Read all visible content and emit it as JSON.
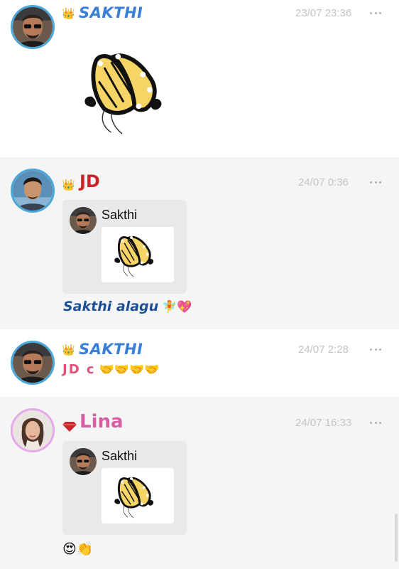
{
  "colors": {
    "post_bg_alt": "#f5f5f5",
    "timestamp": "#c4c4c4",
    "ring_blue": "#4aa7d9",
    "ring_pink": "#e4a8e8",
    "sakthi_blue": "#3a7fd6",
    "jd_red": "#c8252b",
    "lina_pink": "#d75ea3",
    "msg_blue": "#1d4f97",
    "msg_pink": "#e0527a"
  },
  "posts": [
    {
      "username": "SAKTHI",
      "badge_icon": "crown-icon",
      "timestamp": "23/07 23:36",
      "sticker": "butterfly-sticker"
    },
    {
      "username": "JD",
      "badge_icon": "crown-icon",
      "timestamp": "24/07 0:36",
      "quote": {
        "author": "Sakthi",
        "sticker": "butterfly-sticker"
      },
      "message": "Sakthi alagu",
      "emoji": "🧚💖"
    },
    {
      "username": "SAKTHI",
      "badge_icon": "crown-icon",
      "timestamp": "24/07 2:28",
      "message": "JD c",
      "emoji": "🤝🤝🤝🤝"
    },
    {
      "username": "Lina",
      "badge_icon": "diamond-icon",
      "timestamp": "24/07 16:33",
      "quote": {
        "author": "Sakthi",
        "sticker": "butterfly-sticker"
      },
      "emoji": "😍👏"
    }
  ]
}
